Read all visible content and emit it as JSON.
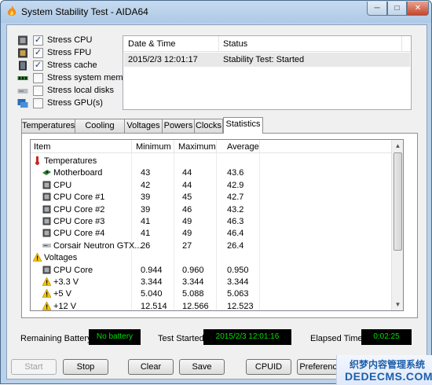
{
  "window": {
    "title": "System Stability Test - AIDA64",
    "controls": {
      "minimize": "─",
      "maximize": "□",
      "close": "✕"
    }
  },
  "stress_options": [
    {
      "label": "Stress CPU",
      "checked": true,
      "icon": "cpu-icon"
    },
    {
      "label": "Stress FPU",
      "checked": true,
      "icon": "fpu-icon"
    },
    {
      "label": "Stress cache",
      "checked": true,
      "icon": "cache-icon"
    },
    {
      "label": "Stress system memory",
      "checked": false,
      "icon": "memory-icon"
    },
    {
      "label": "Stress local disks",
      "checked": false,
      "icon": "disk-icon"
    },
    {
      "label": "Stress GPU(s)",
      "checked": false,
      "icon": "gpu-icon"
    }
  ],
  "log": {
    "columns": [
      "Date & Time",
      "Status"
    ],
    "rows": [
      {
        "datetime": "2015/2/3 12:01:17",
        "status": "Stability Test: Started"
      }
    ]
  },
  "tabs": [
    "Temperatures",
    "Cooling Fans",
    "Voltages",
    "Powers",
    "Clocks",
    "Statistics"
  ],
  "active_tab": "Statistics",
  "statistics": {
    "columns": [
      "Item",
      "Minimum",
      "Maximum",
      "Average"
    ],
    "rows": [
      {
        "type": "group",
        "item": "Temperatures",
        "icon": "thermometer-icon"
      },
      {
        "type": "item",
        "item": "Motherboard",
        "min": "43",
        "max": "44",
        "avg": "43.6",
        "icon": "motherboard-icon"
      },
      {
        "type": "item",
        "item": "CPU",
        "min": "42",
        "max": "44",
        "avg": "42.9",
        "icon": "chip-icon"
      },
      {
        "type": "item",
        "item": "CPU Core #1",
        "min": "39",
        "max": "45",
        "avg": "42.7",
        "icon": "chip-icon"
      },
      {
        "type": "item",
        "item": "CPU Core #2",
        "min": "39",
        "max": "46",
        "avg": "43.2",
        "icon": "chip-icon"
      },
      {
        "type": "item",
        "item": "CPU Core #3",
        "min": "41",
        "max": "49",
        "avg": "46.3",
        "icon": "chip-icon"
      },
      {
        "type": "item",
        "item": "CPU Core #4",
        "min": "41",
        "max": "49",
        "avg": "46.4",
        "icon": "chip-icon"
      },
      {
        "type": "item",
        "item": "Corsair Neutron GTX...",
        "min": "26",
        "max": "27",
        "avg": "26.4",
        "icon": "drive-icon"
      },
      {
        "type": "group",
        "item": "Voltages",
        "icon": "warning-icon"
      },
      {
        "type": "item",
        "item": "CPU Core",
        "min": "0.944",
        "max": "0.960",
        "avg": "0.950",
        "icon": "chip-icon"
      },
      {
        "type": "item",
        "item": "+3.3 V",
        "min": "3.344",
        "max": "3.344",
        "avg": "3.344",
        "icon": "warning-icon"
      },
      {
        "type": "item",
        "item": "+5 V",
        "min": "5.040",
        "max": "5.088",
        "avg": "5.063",
        "icon": "warning-icon"
      },
      {
        "type": "item",
        "item": "+12 V",
        "min": "12.514",
        "max": "12.566",
        "avg": "12.523",
        "icon": "warning-icon"
      }
    ]
  },
  "status": {
    "battery_label": "Remaining Battery:",
    "battery_value": "No battery",
    "started_label": "Test Started:",
    "started_value": "2015/2/3 12:01:16",
    "elapsed_label": "Elapsed Time:",
    "elapsed_value": "0:02:25"
  },
  "buttons": {
    "start": "Start",
    "stop": "Stop",
    "clear": "Clear",
    "save": "Save",
    "cpuid": "CPUID",
    "preferences": "Preferences"
  },
  "watermark": {
    "line1": "织梦内容管理系统",
    "line2": "DEDECMS.COM"
  },
  "colors": {
    "lcd_text": "#00e000",
    "lcd_bg": "#000000",
    "titlebar": "#b9d1ea"
  }
}
